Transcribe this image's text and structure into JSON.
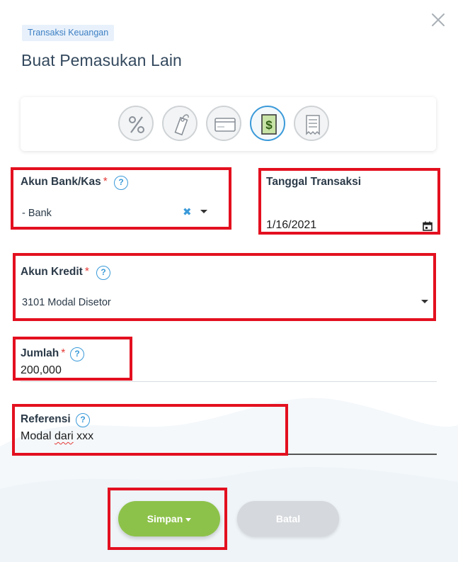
{
  "header": {
    "breadcrumb": "Transaksi Keuangan",
    "title": "Buat Pemasukan Lain"
  },
  "transaction_types": [
    {
      "icon": "percent-icon",
      "active": false
    },
    {
      "icon": "price-tag-icon",
      "active": false
    },
    {
      "icon": "credit-card-icon",
      "active": false
    },
    {
      "icon": "dollar-bill-icon",
      "active": true
    },
    {
      "icon": "receipt-icon",
      "active": false
    }
  ],
  "form": {
    "bank_account": {
      "label": "Akun Bank/Kas",
      "required_mark": "*",
      "help": "?",
      "value": "- Bank"
    },
    "transaction_date": {
      "label": "Tanggal Transaksi",
      "value": "1/16/2021"
    },
    "credit_account": {
      "label": "Akun Kredit",
      "required_mark": "*",
      "help": "?",
      "value": "3101 Modal Disetor"
    },
    "amount": {
      "label": "Jumlah",
      "required_mark": "*",
      "help": "?",
      "value": "200,000"
    },
    "reference": {
      "label": "Referensi",
      "help": "?",
      "value_part1": "Modal ",
      "value_part2": "dari",
      "value_part3": " xxx"
    }
  },
  "actions": {
    "save_label": "Simpan",
    "cancel_label": "Batal"
  },
  "colors": {
    "accent": "#3a9ad9",
    "save": "#8dc24a",
    "cancel_disabled": "#d5d8dc",
    "required": "#e53935",
    "highlight": "#e3101f"
  }
}
